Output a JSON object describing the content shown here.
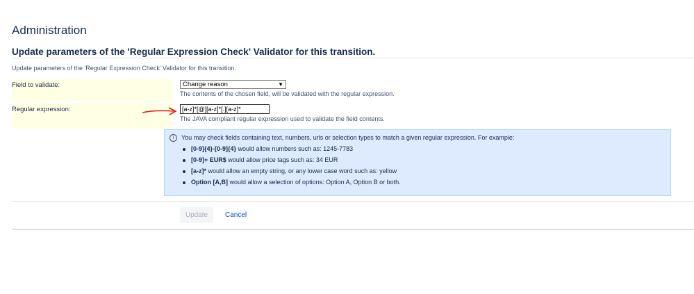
{
  "page": {
    "title": "Administration"
  },
  "form": {
    "heading": "Update parameters of the 'Regular Expression Check' Validator for this transition.",
    "description": "Update parameters of the 'Regular Expression Check' Validator for this transition.",
    "field_to_validate": {
      "label": "Field to validate:",
      "selected_value": "Change reason",
      "help": "The contents of the chosen field, will be validated with the regular expression."
    },
    "regular_expression": {
      "label": "Regular expression:",
      "value": "[a-z]*[@][a-z]*[.][a-z]*",
      "help": "The JAVA compliant regular expression used to validate the field contents."
    }
  },
  "info": {
    "icon": "info-icon",
    "intro": "You may check fields containing text, numbers, urls or selection types to match a given regular expression. For example:",
    "examples": [
      {
        "code": "[0-9]{4}-[0-9]{4}",
        "text": " would allow numbers such as: 1245-7783"
      },
      {
        "code": "[0-9]+ EUR$",
        "text": " would allow price tags such as: 34 EUR"
      },
      {
        "code": "[a-z]*",
        "text": " would allow an empty string, or any lower case word such as: yellow"
      },
      {
        "code": "Option [A,B]",
        "text": " would allow a selection of options: Option A, Option B or both."
      }
    ]
  },
  "actions": {
    "update_label": "Update",
    "cancel_label": "Cancel"
  },
  "colors": {
    "annotation_arrow": "#e0201b",
    "link": "#0052cc",
    "info_background": "#deebff",
    "field_row_background": "#ffffe4"
  }
}
